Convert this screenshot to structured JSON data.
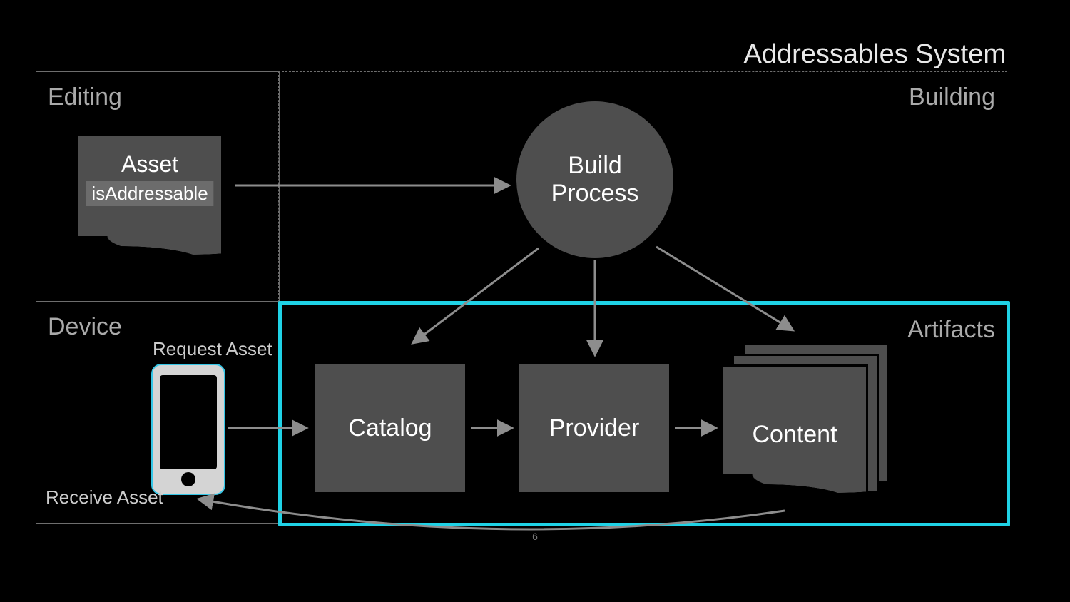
{
  "title": "Addressables System",
  "panels": {
    "editing": "Editing",
    "building": "Building",
    "device": "Device",
    "artifacts": "Artifacts"
  },
  "asset": {
    "title": "Asset",
    "tag": "isAddressable"
  },
  "build": {
    "line1": "Build",
    "line2": "Process"
  },
  "boxes": {
    "catalog": "Catalog",
    "provider": "Provider",
    "content": "Content"
  },
  "device": {
    "request": "Request Asset",
    "receive": "Receive Asset"
  },
  "page": "6",
  "flow": [
    "Asset → Build Process",
    "Build Process → Catalog",
    "Build Process → Provider",
    "Build Process → Content",
    "Device → Catalog",
    "Catalog → Provider",
    "Provider → Content",
    "Content → Device (return)"
  ]
}
